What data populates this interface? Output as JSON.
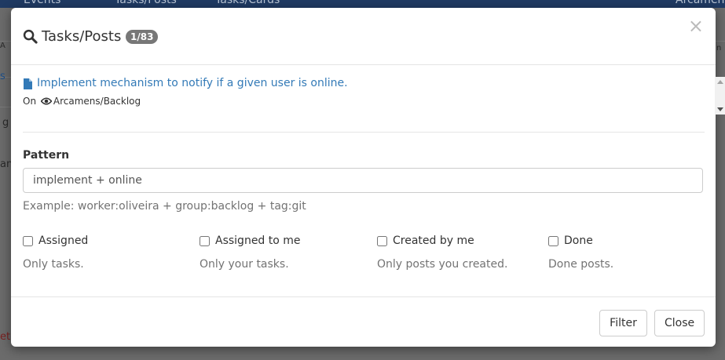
{
  "background": {
    "nav_items": [
      "Events",
      "Tasks/Posts",
      "Tasks/Cards",
      "Arcamens"
    ],
    "side_fragments": [
      "A",
      "s",
      "g",
      "an",
      "ete",
      "n"
    ]
  },
  "modal": {
    "title": "Tasks/Posts",
    "count_badge": "1/83",
    "close_symbol": "×",
    "results": [
      {
        "title": "Implement mechanism to notify if a given user is online.",
        "meta_prefix": "On",
        "location": "Arcamens/Backlog"
      }
    ],
    "pattern": {
      "label": "Pattern",
      "value": "implement + online",
      "help": "Example: worker:oliveira + group:backlog + tag:git"
    },
    "filters": [
      {
        "label": "Assigned",
        "help": "Only tasks.",
        "checked": false
      },
      {
        "label": "Assigned to me",
        "help": "Only your tasks.",
        "checked": false
      },
      {
        "label": "Created by me",
        "help": "Only posts you created.",
        "checked": false
      },
      {
        "label": "Done",
        "help": "Done posts.",
        "checked": false
      }
    ],
    "buttons": {
      "filter": "Filter",
      "close": "Close"
    }
  },
  "colors": {
    "link": "#337ab7",
    "badge": "#777777",
    "help_text": "#737373",
    "nav": "#1f3a63"
  }
}
